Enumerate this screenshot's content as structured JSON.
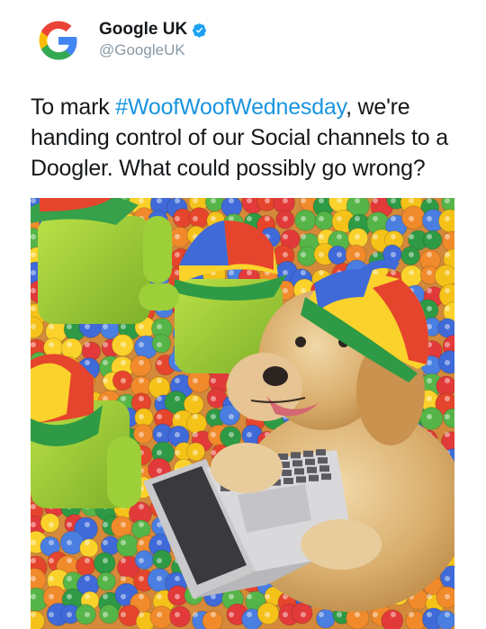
{
  "tweet": {
    "author": {
      "display_name": "Google UK",
      "handle": "@GoogleUK",
      "verified": true,
      "avatar_icon": "google-g-logo"
    },
    "text": {
      "prefix": "To mark ",
      "hashtag": "#WoofWoofWednesday",
      "suffix": ", we're handing control of our Social channels to a Doogler. What could possibly go wrong?"
    },
    "media": {
      "description_icon": "dog-in-ball-pit-photo"
    }
  },
  "colors": {
    "text": "#14171a",
    "handle": "#8899a6",
    "link": "#1b95e0",
    "verified": "#1da1f2",
    "google_blue": "#4285F4",
    "google_red": "#EA4335",
    "google_yellow": "#FBBC05",
    "google_green": "#34A853"
  }
}
